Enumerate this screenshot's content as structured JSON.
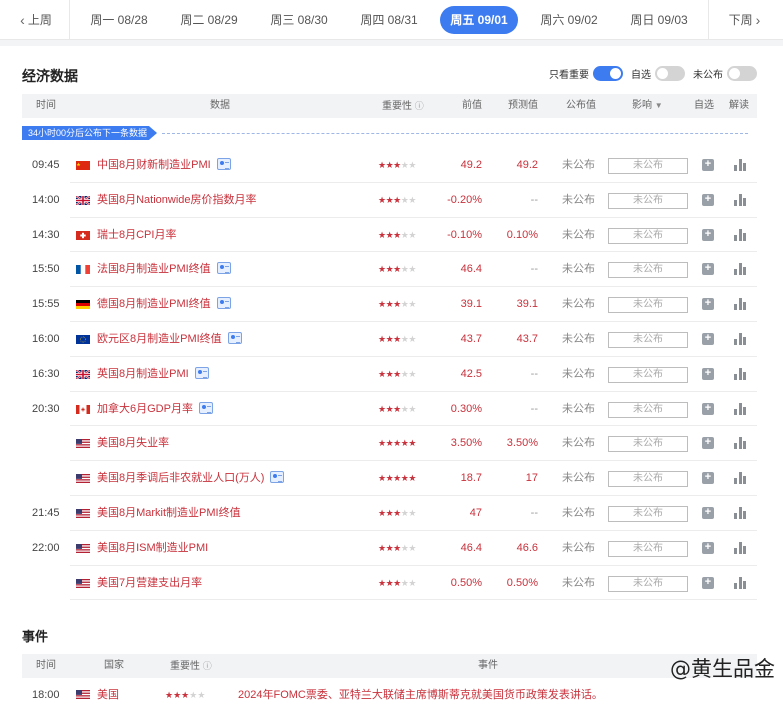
{
  "nav": {
    "prev_label": "上周",
    "next_label": "下周",
    "days": [
      {
        "label": "周一 08/28",
        "active": false
      },
      {
        "label": "周二 08/29",
        "active": false
      },
      {
        "label": "周三 08/30",
        "active": false
      },
      {
        "label": "周四 08/31",
        "active": false
      },
      {
        "label": "周五 09/01",
        "active": true
      },
      {
        "label": "周六 09/02",
        "active": false
      },
      {
        "label": "周日 09/03",
        "active": false
      }
    ]
  },
  "econ": {
    "title": "经济数据",
    "toggles": [
      {
        "label": "只看重要",
        "on": true
      },
      {
        "label": "自选",
        "on": false
      },
      {
        "label": "未公布",
        "on": false
      }
    ],
    "columns": {
      "time": "时间",
      "data": "数据",
      "importance": "重要性",
      "previous": "前值",
      "forecast": "预测值",
      "published": "公布值",
      "impact": "影响",
      "watch": "自选",
      "explain": "解读"
    },
    "next_release": "34小时00分后公布下一条数据",
    "rows": [
      {
        "time": "09:45",
        "flag": "cn",
        "name": "中国8月财新制造业PMI",
        "doc": true,
        "stars": 3,
        "previous": "49.2",
        "forecast": "49.2",
        "published": "未公布",
        "impact": "未公布"
      },
      {
        "time": "14:00",
        "flag": "uk",
        "name": "英国8月Nationwide房价指数月率",
        "doc": false,
        "stars": 3,
        "previous": "-0.20%",
        "forecast": "--",
        "published": "未公布",
        "impact": "未公布"
      },
      {
        "time": "14:30",
        "flag": "ch",
        "name": "瑞士8月CPI月率",
        "doc": false,
        "stars": 3,
        "previous": "-0.10%",
        "forecast": "0.10%",
        "published": "未公布",
        "impact": "未公布"
      },
      {
        "time": "15:50",
        "flag": "fr",
        "name": "法国8月制造业PMI终值",
        "doc": true,
        "stars": 3,
        "previous": "46.4",
        "forecast": "--",
        "published": "未公布",
        "impact": "未公布"
      },
      {
        "time": "15:55",
        "flag": "de",
        "name": "德国8月制造业PMI终值",
        "doc": true,
        "stars": 3,
        "previous": "39.1",
        "forecast": "39.1",
        "published": "未公布",
        "impact": "未公布"
      },
      {
        "time": "16:00",
        "flag": "eu",
        "name": "欧元区8月制造业PMI终值",
        "doc": true,
        "stars": 3,
        "previous": "43.7",
        "forecast": "43.7",
        "published": "未公布",
        "impact": "未公布"
      },
      {
        "time": "16:30",
        "flag": "uk",
        "name": "英国8月制造业PMI",
        "doc": true,
        "stars": 3,
        "previous": "42.5",
        "forecast": "--",
        "published": "未公布",
        "impact": "未公布"
      },
      {
        "time": "20:30",
        "flag": "ca",
        "name": "加拿大6月GDP月率",
        "doc": true,
        "stars": 3,
        "previous": "0.30%",
        "forecast": "--",
        "published": "未公布",
        "impact": "未公布"
      },
      {
        "time": "",
        "flag": "us",
        "name": "美国8月失业率",
        "doc": false,
        "stars": 5,
        "previous": "3.50%",
        "forecast": "3.50%",
        "published": "未公布",
        "impact": "未公布"
      },
      {
        "time": "",
        "flag": "us",
        "name": "美国8月季调后非农就业人口(万人)",
        "doc": true,
        "stars": 5,
        "previous": "18.7",
        "forecast": "17",
        "published": "未公布",
        "impact": "未公布"
      },
      {
        "time": "21:45",
        "flag": "us",
        "name": "美国8月Markit制造业PMI终值",
        "doc": false,
        "stars": 3,
        "previous": "47",
        "forecast": "--",
        "published": "未公布",
        "impact": "未公布"
      },
      {
        "time": "22:00",
        "flag": "us",
        "name": "美国8月ISM制造业PMI",
        "doc": false,
        "stars": 3,
        "previous": "46.4",
        "forecast": "46.6",
        "published": "未公布",
        "impact": "未公布"
      },
      {
        "time": "",
        "flag": "us",
        "name": "美国7月营建支出月率",
        "doc": false,
        "stars": 3,
        "previous": "0.50%",
        "forecast": "0.50%",
        "published": "未公布",
        "impact": "未公布"
      }
    ]
  },
  "events": {
    "title": "事件",
    "columns": {
      "time": "时间",
      "country": "国家",
      "importance": "重要性",
      "event": "事件"
    },
    "rows": [
      {
        "time": "18:00",
        "flag": "us",
        "country": "美国",
        "stars": 3,
        "desc": "2024年FOMC票委、亚特兰大联储主席博斯蒂克就美国货币政策发表讲话。"
      }
    ]
  },
  "brand": "@黄生品金",
  "colors": {
    "accent": "#3d7cf0",
    "red": "#c8323c"
  }
}
